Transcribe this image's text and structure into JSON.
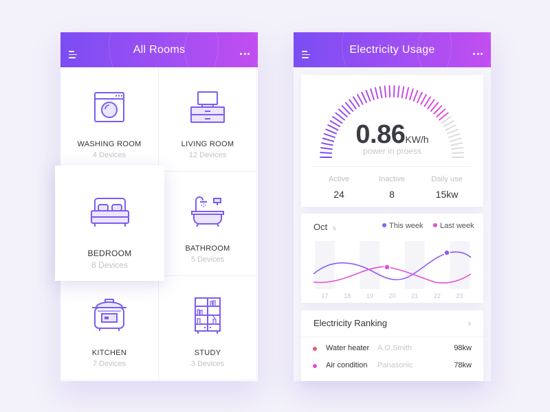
{
  "left_screen": {
    "title": "All Rooms",
    "rooms": [
      {
        "name": "WASHING ROOM",
        "devices": "4 Devices",
        "icon": "washing-machine-icon"
      },
      {
        "name": "LIVING ROOM",
        "devices": "12 Devices",
        "icon": "tv-cabinet-icon"
      },
      {
        "name": "BEDROOM",
        "devices": "8 Devices",
        "icon": "bed-icon"
      },
      {
        "name": "BATHROOM",
        "devices": "5 Devices",
        "icon": "bathtub-icon"
      },
      {
        "name": "KITCHEN",
        "devices": "7 Devices",
        "icon": "rice-cooker-icon"
      },
      {
        "name": "STUDY",
        "devices": "3 Devices",
        "icon": "bookshelf-icon"
      }
    ]
  },
  "right_screen": {
    "title": "Electricity Usage",
    "gauge": {
      "value": "0.86",
      "unit": "KW/h",
      "subtitle": "power in proess",
      "fraction": 0.8
    },
    "stats": [
      {
        "label": "Active",
        "value": "24"
      },
      {
        "label": "Inactive",
        "value": "8"
      },
      {
        "label": "Daily use",
        "value": "15kw"
      }
    ],
    "chart": {
      "month": "Oct",
      "legend": [
        "This week",
        "Last week"
      ],
      "days": [
        "17",
        "18",
        "19",
        "20",
        "21",
        "22",
        "23"
      ]
    },
    "ranking": {
      "title": "Electricity Ranking",
      "items": [
        {
          "name": "Water heater",
          "brand": "A.O.Smith",
          "value": "98kw",
          "color": "#f3566f"
        },
        {
          "name": "Air condition",
          "brand": "Panasonic",
          "value": "78kw",
          "color": "#e24fd6"
        }
      ]
    }
  },
  "colors": {
    "gradient_start": "#7a4df3",
    "gradient_end": "#c24ef0",
    "accent_purple": "#8a5cf5",
    "accent_pink": "#e24fd6",
    "icon_purple": "#7b5cf0"
  }
}
